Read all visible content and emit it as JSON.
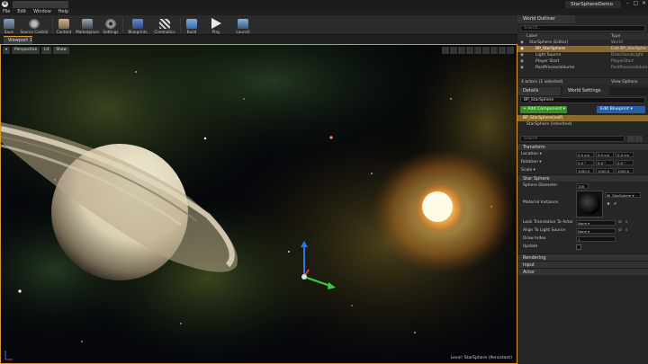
{
  "window": {
    "logo": "U",
    "project_tab": "StarSphereDemo",
    "minimize": "–",
    "maximize": "□",
    "close": "✕"
  },
  "menu": [
    "File",
    "Edit",
    "Window",
    "Help"
  ],
  "toolbar": {
    "save": "Save",
    "source_control": "Source Control",
    "content": "Content",
    "marketplace": "Marketplace",
    "settings": "Settings",
    "blueprints": "Blueprints",
    "cinematics": "Cinematics",
    "build": "Build",
    "play": "Play",
    "launch": "Launch"
  },
  "viewport": {
    "tab_label": "Viewport 1",
    "menu_arrow": "▾",
    "perspective": "Perspective",
    "lit": "Lit",
    "show": "Show",
    "level_label": "Level:  StarSphere (Persistent)"
  },
  "outliner": {
    "tab": "World Outliner",
    "search_placeholder": "Search...",
    "col_label": "Label",
    "col_type": "Type",
    "rows": [
      {
        "label": "StarSphere (Editor)",
        "type": "World",
        "selected": false
      },
      {
        "label": "BP_StarSphere",
        "type": "Edit BP_StarSphe",
        "selected": true
      },
      {
        "label": "Light Source",
        "type": "DirectionalLight",
        "selected": false
      },
      {
        "label": "Player Start",
        "type": "PlayerStart",
        "selected": false
      },
      {
        "label": "PostProcessVolume",
        "type": "PostProcessVolum",
        "selected": false
      }
    ],
    "footer": "4 actors (1 selected)",
    "view_options": "View Options"
  },
  "details": {
    "tab_details": "Details",
    "tab_world_settings": "World Settings",
    "actor_name": "BP_StarSphere",
    "add_component": "+ Add Component ▾",
    "edit_blueprint": "Edit Blueprint ▾",
    "component_self": "BP_StarSphere(self)",
    "component_inherited": "StarSphere (Inherited)",
    "search_placeholder": "Search",
    "transform": {
      "title": "Transform",
      "location": {
        "label": "Location ▾",
        "x": "0.0 cm",
        "y": "0.0 cm",
        "z": "0.0 cm"
      },
      "rotation": {
        "label": "Rotation ▾",
        "x": "0.0 °",
        "y": "0.0 °",
        "z": "0.0 °"
      },
      "scale": {
        "label": "Scale ▾",
        "x": "1000.0",
        "y": "1000.0",
        "z": "1000.0"
      }
    },
    "star_sphere": {
      "title": "Star Sphere",
      "sphere_diameter_label": "Sphere Diameter",
      "sphere_diameter": "100",
      "material_label": "Material Instance",
      "material_value": "MI_StarSphere ▾",
      "look_translation_label": "Look Translation To Actor",
      "look_translation_value": "None ▾",
      "align_light_label": "Align To Light Source",
      "align_light_value": "None ▾",
      "draw_index_label": "Draw Index",
      "draw_index": "1",
      "update_label": "Update"
    },
    "rendering": "Rendering",
    "input": "Input",
    "actor": "Actor"
  },
  "colors": {
    "accent_orange": "#d89a2a",
    "add_component_green": "#3d8c2a",
    "edit_blueprint_blue": "#2a5fa8",
    "selection": "#8a6a2a"
  }
}
